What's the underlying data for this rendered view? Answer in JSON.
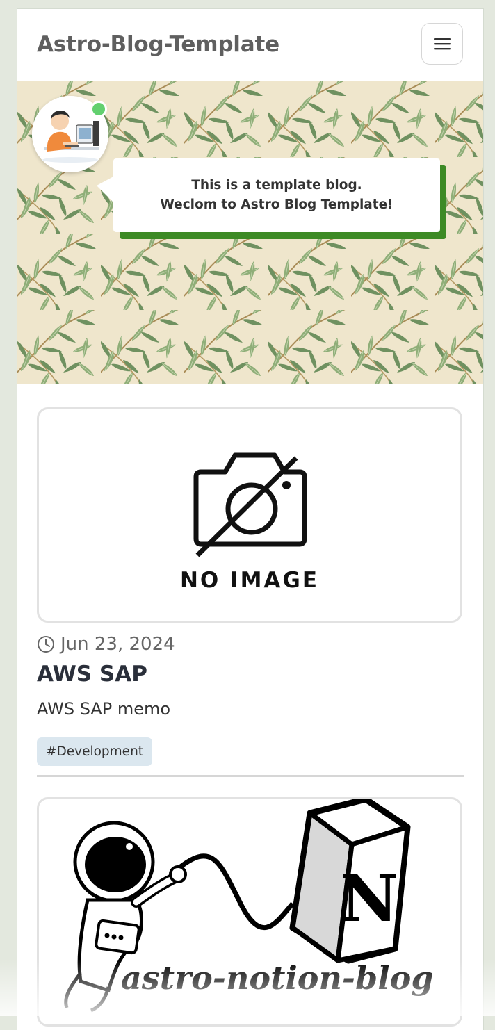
{
  "header": {
    "site_title": "Astro-Blog-Template",
    "menu_icon": "hamburger-menu-icon"
  },
  "hero": {
    "message_line1": "This is a template blog.",
    "message_line2": "Weclom to Astro Blog Template!",
    "status_color": "#62d06f",
    "accent_color": "#3d8a25"
  },
  "posts": [
    {
      "image_text": "NO IMAGE",
      "date": "Jun 23, 2024",
      "title": "AWS SAP",
      "description": "AWS SAP memo",
      "tag": "#Development"
    },
    {
      "image_text": "astro-notion-blog",
      "image_letter": "N"
    }
  ]
}
